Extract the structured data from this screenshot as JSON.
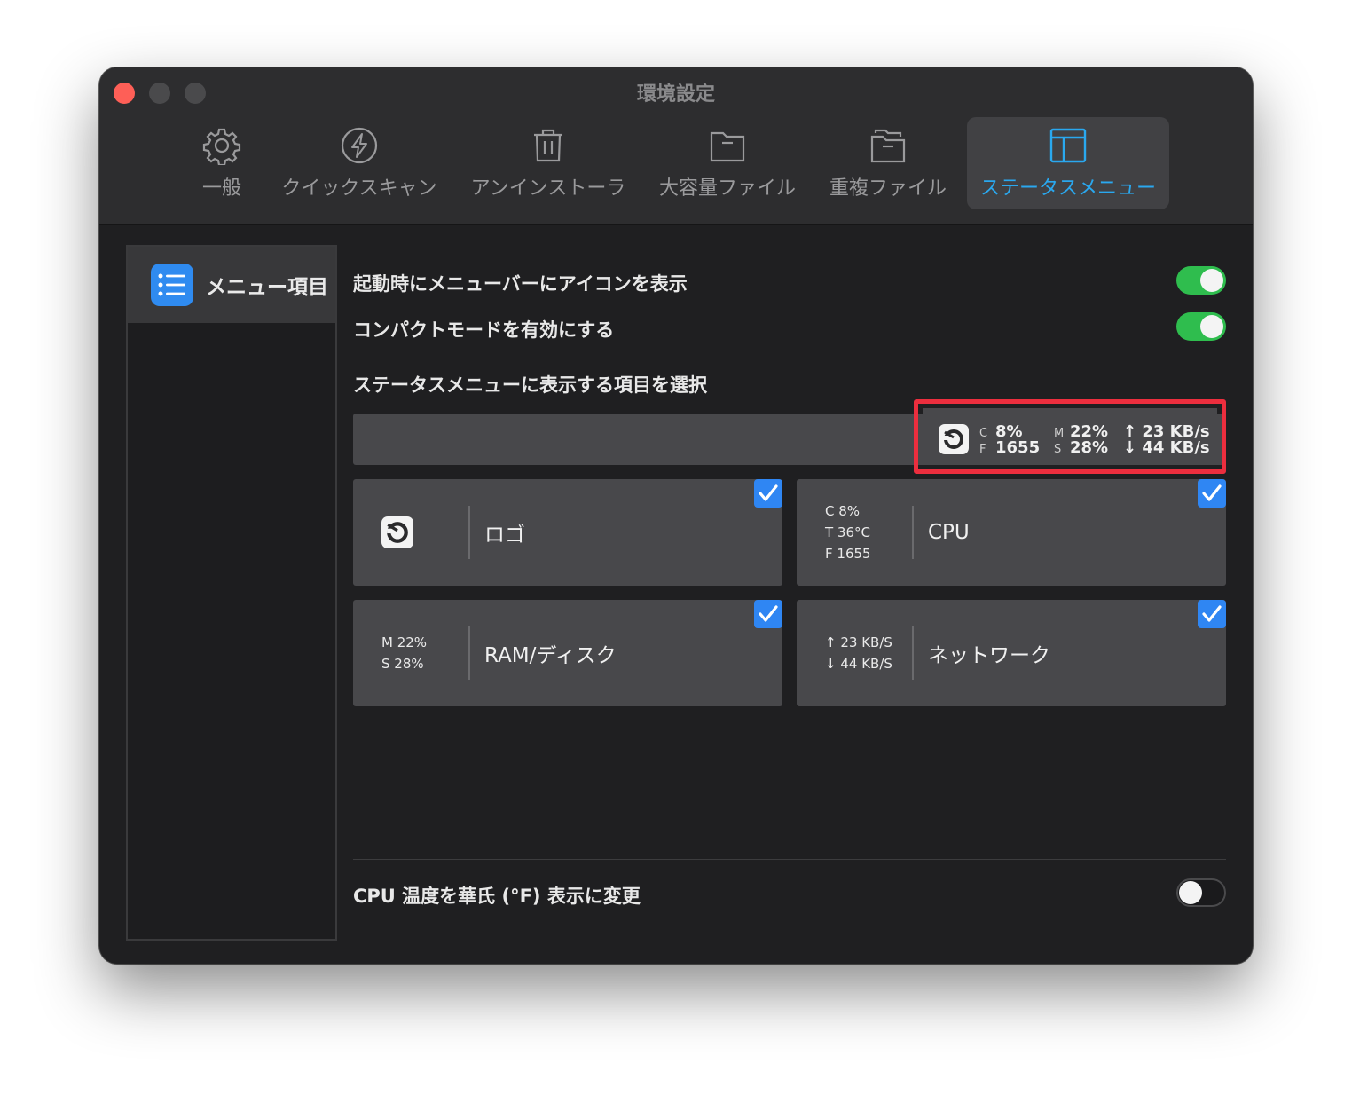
{
  "window": {
    "title": "環境設定"
  },
  "tabs": [
    {
      "label": "一般",
      "icon": "gear-icon"
    },
    {
      "label": "クイックスキャン",
      "icon": "lightning-icon"
    },
    {
      "label": "アンインストーラ",
      "icon": "trash-icon"
    },
    {
      "label": "大容量ファイル",
      "icon": "folder-icon"
    },
    {
      "label": "重複ファイル",
      "icon": "duplicate-folder-icon"
    },
    {
      "label": "ステータスメニュー",
      "icon": "layout-icon",
      "active": true
    }
  ],
  "sidebar": {
    "items": [
      {
        "label": "メニュー項目",
        "icon": "list-icon",
        "selected": true
      }
    ]
  },
  "settings": {
    "show_icon": {
      "label": "起動時にメニューバーにアイコンを表示",
      "on": true
    },
    "compact": {
      "label": "コンパクトモードを有効にする",
      "on": true
    },
    "select_heading": "ステータスメニューに表示する項目を選択",
    "fahrenheit": {
      "label": "CPU 温度を華氏 (°F) 表示に変更",
      "on": false
    }
  },
  "preview": {
    "cpu": {
      "k1": "C",
      "v1": "8%",
      "k2": "F",
      "v2": "1655"
    },
    "mem": {
      "k1": "M",
      "v1": "22%",
      "k2": "S",
      "v2": "28%"
    },
    "net": {
      "up": "↑ 23 KB/s",
      "down": "↓ 44 KB/s"
    }
  },
  "cards": [
    {
      "name": "ロゴ",
      "checked": true,
      "stats": []
    },
    {
      "name": "CPU",
      "checked": true,
      "stats": [
        "C 8%",
        "T 36°C",
        "F 1655"
      ]
    },
    {
      "name": "RAM/ディスク",
      "checked": true,
      "stats": [
        "M 22%",
        "S 28%"
      ]
    },
    {
      "name": "ネットワーク",
      "checked": true,
      "stats": [
        "↑ 23 KB/S",
        "↓ 44 KB/S"
      ]
    }
  ],
  "colors": {
    "accent": "#2aa8ef",
    "toggle_on": "#2fbd4e",
    "highlight": "#ec2e3e",
    "checkbox": "#2f86f3"
  }
}
